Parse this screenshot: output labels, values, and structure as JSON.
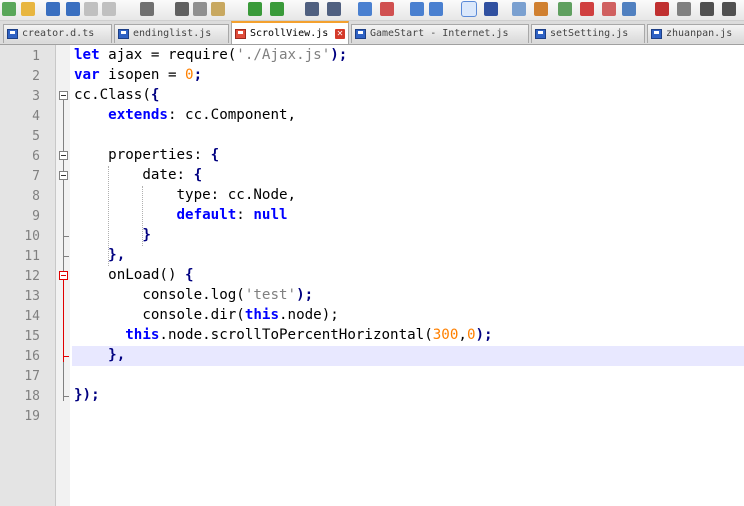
{
  "toolbar": {
    "icons": [
      "new-file",
      "open-file",
      "save",
      "save-all",
      "close",
      "close-all",
      "print",
      "cut",
      "copy",
      "paste",
      "undo",
      "redo",
      "find",
      "replace",
      "zoom-in",
      "zoom-out",
      "sync-vertical",
      "sync-horizontal",
      "word-wrap",
      "show-all-chars",
      "indent-guide",
      "user-defined-language",
      "document-map",
      "function-list",
      "folder-as-workspace",
      "monitoring",
      "record-macro",
      "stop-recording",
      "playback-macro",
      "run-macro-multiple"
    ]
  },
  "tabs": [
    {
      "label": "creator.d.ts",
      "active": false
    },
    {
      "label": "endinglist.js",
      "active": false
    },
    {
      "label": "ScrollView.js",
      "active": true
    },
    {
      "label": "GameStart - Internet.js",
      "active": false
    },
    {
      "label": "setSetting.js",
      "active": false
    },
    {
      "label": "zhuanpan.js",
      "active": false
    }
  ],
  "editor": {
    "line_numbers": [
      "1",
      "2",
      "3",
      "4",
      "5",
      "6",
      "7",
      "8",
      "9",
      "10",
      "11",
      "12",
      "13",
      "14",
      "15",
      "16",
      "17",
      "18",
      "19"
    ],
    "current_line": 16,
    "lines": [
      [
        {
          "t": "let",
          "c": "kw"
        },
        {
          "t": " ajax = require(",
          "c": "id"
        },
        {
          "t": "'./Ajax.js'",
          "c": "str"
        },
        {
          "t": ");",
          "c": "op"
        }
      ],
      [
        {
          "t": "var",
          "c": "kw"
        },
        {
          "t": " isopen = ",
          "c": "id"
        },
        {
          "t": "0",
          "c": "num"
        },
        {
          "t": ";",
          "c": "op"
        }
      ],
      [
        {
          "t": "cc.Class(",
          "c": "id"
        },
        {
          "t": "{",
          "c": "op"
        }
      ],
      [
        {
          "t": "    ",
          "c": "id"
        },
        {
          "t": "extends",
          "c": "kw"
        },
        {
          "t": ": cc.Component,",
          "c": "id"
        }
      ],
      [
        {
          "t": "",
          "c": "id"
        }
      ],
      [
        {
          "t": "    properties: ",
          "c": "id"
        },
        {
          "t": "{",
          "c": "op"
        }
      ],
      [
        {
          "t": "        date: ",
          "c": "id"
        },
        {
          "t": "{",
          "c": "op"
        }
      ],
      [
        {
          "t": "            type: cc.Node,",
          "c": "id"
        }
      ],
      [
        {
          "t": "            ",
          "c": "id"
        },
        {
          "t": "default",
          "c": "kw"
        },
        {
          "t": ": ",
          "c": "id"
        },
        {
          "t": "null",
          "c": "kw"
        }
      ],
      [
        {
          "t": "        ",
          "c": "id"
        },
        {
          "t": "}",
          "c": "op"
        }
      ],
      [
        {
          "t": "    ",
          "c": "id"
        },
        {
          "t": "},",
          "c": "op"
        }
      ],
      [
        {
          "t": "    onLoad() ",
          "c": "id"
        },
        {
          "t": "{",
          "c": "op"
        }
      ],
      [
        {
          "t": "        console.log(",
          "c": "id"
        },
        {
          "t": "'test'",
          "c": "str"
        },
        {
          "t": ");",
          "c": "op"
        }
      ],
      [
        {
          "t": "        console.dir(",
          "c": "id"
        },
        {
          "t": "this",
          "c": "kw"
        },
        {
          "t": ".node);",
          "c": "id"
        }
      ],
      [
        {
          "t": "      ",
          "c": "id"
        },
        {
          "t": "this",
          "c": "kw"
        },
        {
          "t": ".node.scrollToPercentHorizontal(",
          "c": "id"
        },
        {
          "t": "300",
          "c": "num"
        },
        {
          "t": ",",
          "c": "id"
        },
        {
          "t": "0",
          "c": "num"
        },
        {
          "t": ");",
          "c": "op"
        }
      ],
      [
        {
          "t": "    ",
          "c": "id"
        },
        {
          "t": "},",
          "c": "op"
        }
      ],
      [
        {
          "t": "",
          "c": "id"
        }
      ],
      [
        {
          "t": "});",
          "c": "op"
        }
      ],
      [
        {
          "t": "",
          "c": "id"
        }
      ]
    ]
  }
}
